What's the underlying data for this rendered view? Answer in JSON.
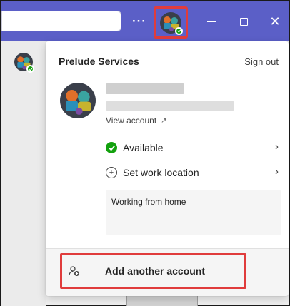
{
  "titlebar": {
    "more_label": "···",
    "window_controls": {
      "minimize": "minimize-icon",
      "maximize": "maximize-icon",
      "close": "close-icon"
    },
    "close_glyph": "✕",
    "accent_color": "#5b5fc7"
  },
  "account_card": {
    "org_name": "Prelude Services",
    "sign_out_label": "Sign out",
    "view_account_label": "View account",
    "view_account_icon": "↗",
    "presence": {
      "label": "Available",
      "color": "#13a10e"
    },
    "location_label": "Set work location",
    "location_icon": "+",
    "chevron": "›",
    "status_message": "Working from home",
    "add_account_label": "Add another account",
    "add_account_icon": "⁺"
  },
  "highlight_color": "#e03c3c"
}
